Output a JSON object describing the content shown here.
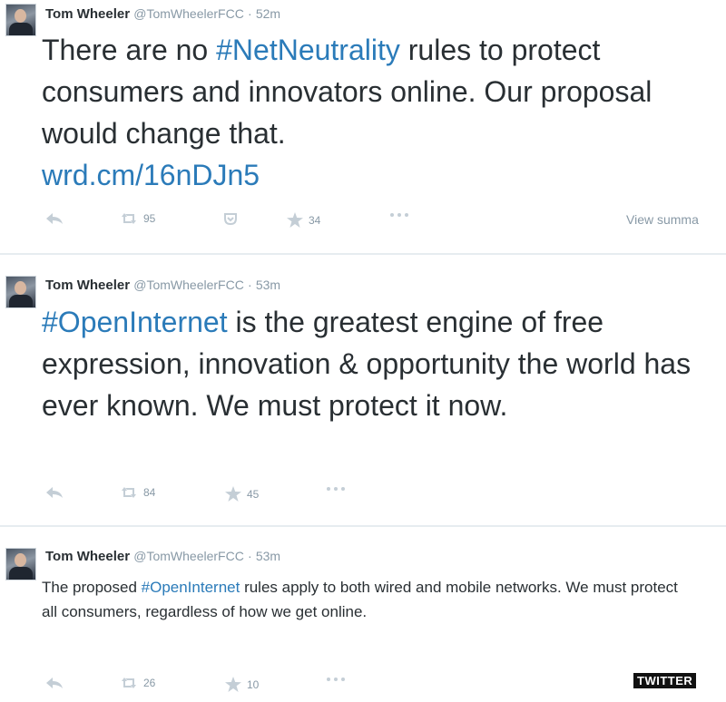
{
  "tweets": [
    {
      "author_name": "Tom Wheeler",
      "handle": "@TomWheelerFCC",
      "dot": "·",
      "time": "52m",
      "text_parts": {
        "before": "There are no ",
        "hashtag": "#NetNeutrality",
        "after": " rules to protect consumers and innovators online. Our proposal would change that.",
        "link": "wrd.cm/16nDJn5"
      },
      "retweet_count": "95",
      "favorite_count": "34",
      "view_summary": "View summa"
    },
    {
      "author_name": "Tom Wheeler",
      "handle": "@TomWheelerFCC",
      "dot": "·",
      "time": "53m",
      "text_parts": {
        "hashtag": "#OpenInternet",
        "after": " is the greatest engine of free expression, innovation & opportunity the world has ever known. We must protect it now."
      },
      "retweet_count": "84",
      "favorite_count": "45"
    },
    {
      "author_name": "Tom Wheeler",
      "handle": "@TomWheelerFCC",
      "dot": "·",
      "time": "53m",
      "text_parts": {
        "before": "The proposed ",
        "hashtag": "#OpenInternet",
        "after": " rules apply to both wired and mobile networks. We must protect all consumers, regardless of how we get online."
      },
      "retweet_count": "26",
      "favorite_count": "10"
    }
  ],
  "watermark": "TWITTER",
  "icons": [
    "reply-icon",
    "retweet-icon",
    "favorite-icon",
    "star-icon",
    "more-icon",
    "avatar"
  ],
  "colors": {
    "link": "#2b7bb9",
    "muted": "#8899a6",
    "text": "#292f33"
  }
}
